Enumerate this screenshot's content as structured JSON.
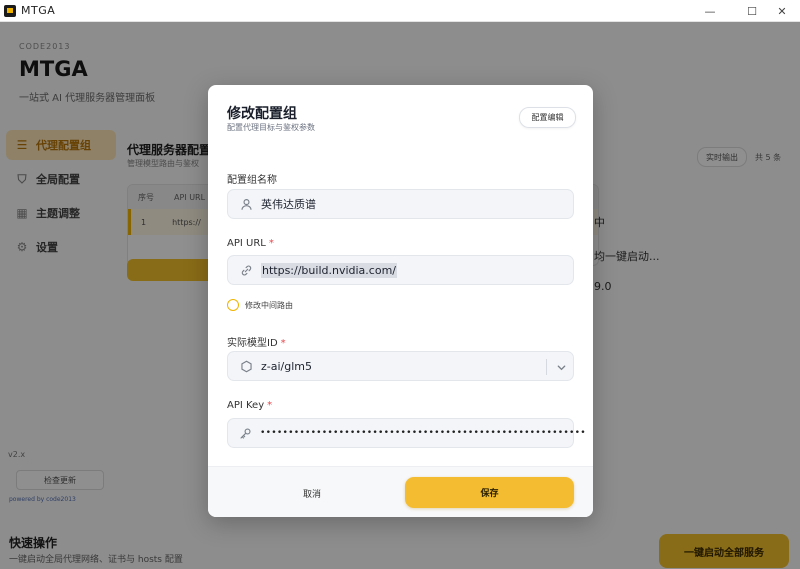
{
  "window": {
    "title": "MTGA",
    "controls": {
      "minimize": "—",
      "maximize": "☐",
      "close": "✕"
    }
  },
  "app": {
    "brand_en": "CODE2013",
    "brand_name": "MTGA",
    "brand_desc": "一站式 AI 代理服务器管理面板",
    "nav": [
      {
        "label": "代理配置组",
        "icon": "list-icon",
        "glyph": "☰"
      },
      {
        "label": "全局配置",
        "icon": "shield-icon",
        "glyph": "⛉"
      },
      {
        "label": "主题调整",
        "icon": "grid-icon",
        "glyph": "▦"
      },
      {
        "label": "设置",
        "icon": "gear-icon",
        "glyph": "⚙"
      }
    ],
    "version": "v2.x",
    "check_update": "检查更新",
    "powered_by": "powered by code2013",
    "quick_title": "快速操作",
    "quick_desc": "一键启动全局代理网络、证书与 hosts 配置",
    "quick_button": "一键启动全部服务",
    "panel_title": "代理服务器配置",
    "panel_sub": "管理模型路由与鉴权",
    "panel_pill": "实时输出",
    "panel_count": "共 5 条",
    "table_headers": [
      "序号",
      "API URL"
    ],
    "table_row": [
      "1",
      "https://"
    ],
    "side_lines": [
      "中",
      "均一键启动...",
      "9.0"
    ]
  },
  "modal": {
    "title": "修改配置组",
    "subtitle": "配置代理目标与鉴权参数",
    "config_edit_button": "配置编辑",
    "name_label": "配置组名称",
    "name_value": "英伟达质谱",
    "url_label": "API URL",
    "url_value": "https://build.nvidia.com/",
    "required_mark": "*",
    "middle_route_label": "修改中间路由",
    "model_label": "实际模型ID",
    "model_value": "z-ai/glm5",
    "key_label": "API Key",
    "key_value": "••••••••••••••••••••••••••••••••••••••••••••••••••••••••••",
    "cancel_button": "取消",
    "save_button": "保存"
  },
  "colors": {
    "accent": "#f4bd31",
    "required": "#e5484d",
    "overlay": "rgba(0,0,0,0.44)"
  }
}
